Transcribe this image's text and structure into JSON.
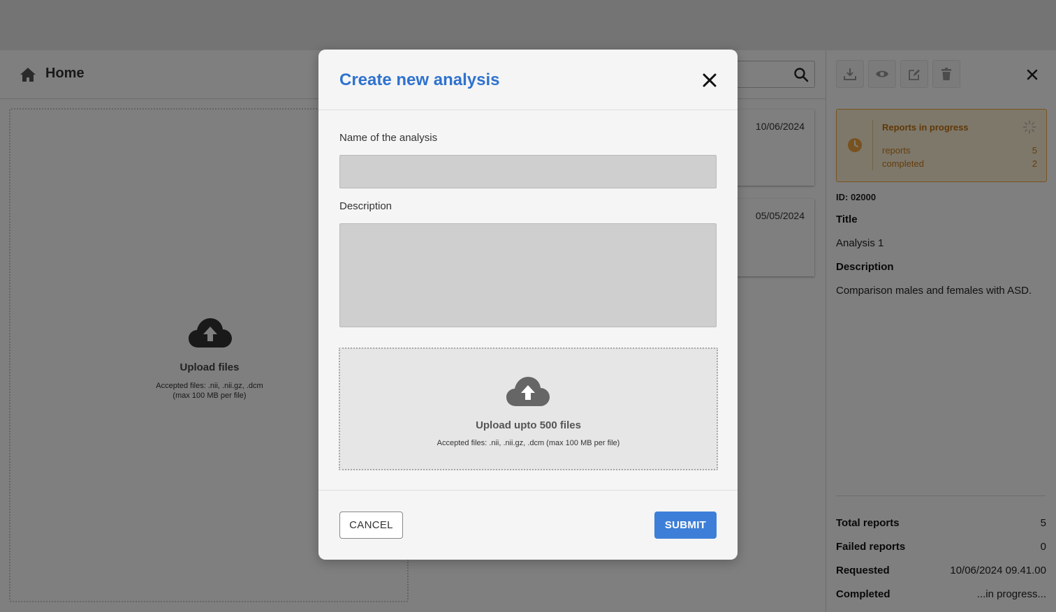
{
  "header": {
    "title": "Home",
    "icon": "home-icon"
  },
  "search": {
    "placeholder": "",
    "icon": "search-icon"
  },
  "upload_area": {
    "title": "Upload files",
    "hint_line1": "Accepted files: .nii, .nii.gz, .dcm",
    "hint_line2": "(max 100 MB per file)",
    "icon": "cloud-upload-icon"
  },
  "cards": [
    {
      "date": "10/06/2024"
    },
    {
      "date": "05/05/2024"
    }
  ],
  "right_panel": {
    "toolbar": {
      "download_icon": "download-icon",
      "view_icon": "eye-icon",
      "edit_icon": "edit-icon",
      "delete_icon": "trash-icon",
      "close_icon": "close-icon"
    },
    "progress": {
      "title": "Reports in progress",
      "reports_label": "reports",
      "reports_value": "5",
      "completed_label": "completed",
      "completed_value": "2",
      "accent_color": "#f0a640"
    },
    "id_text": "ID: 02000",
    "title_label": "Title",
    "title_value": "Analysis 1",
    "description_label": "Description",
    "description_value": "Comparison males and females with ASD.",
    "summary": [
      {
        "label": "Total reports",
        "value": "5"
      },
      {
        "label": "Failed reports",
        "value": "0"
      },
      {
        "label": "Requested",
        "value": "10/06/2024 09.41.00"
      },
      {
        "label": "Completed",
        "value": "...in progress..."
      }
    ]
  },
  "modal": {
    "title": "Create new analysis",
    "name_label": "Name of the analysis",
    "name_value": "",
    "description_label": "Description",
    "description_value": "",
    "dropzone_title": "Upload upto 500 files",
    "dropzone_hint": "Accepted files: .nii, .nii.gz, .dcm (max 100 MB per file)",
    "cancel_label": "CANCEL",
    "submit_label": "SUBMIT",
    "accent_color": "#2f72cf",
    "submit_color": "#3d7fd8"
  }
}
